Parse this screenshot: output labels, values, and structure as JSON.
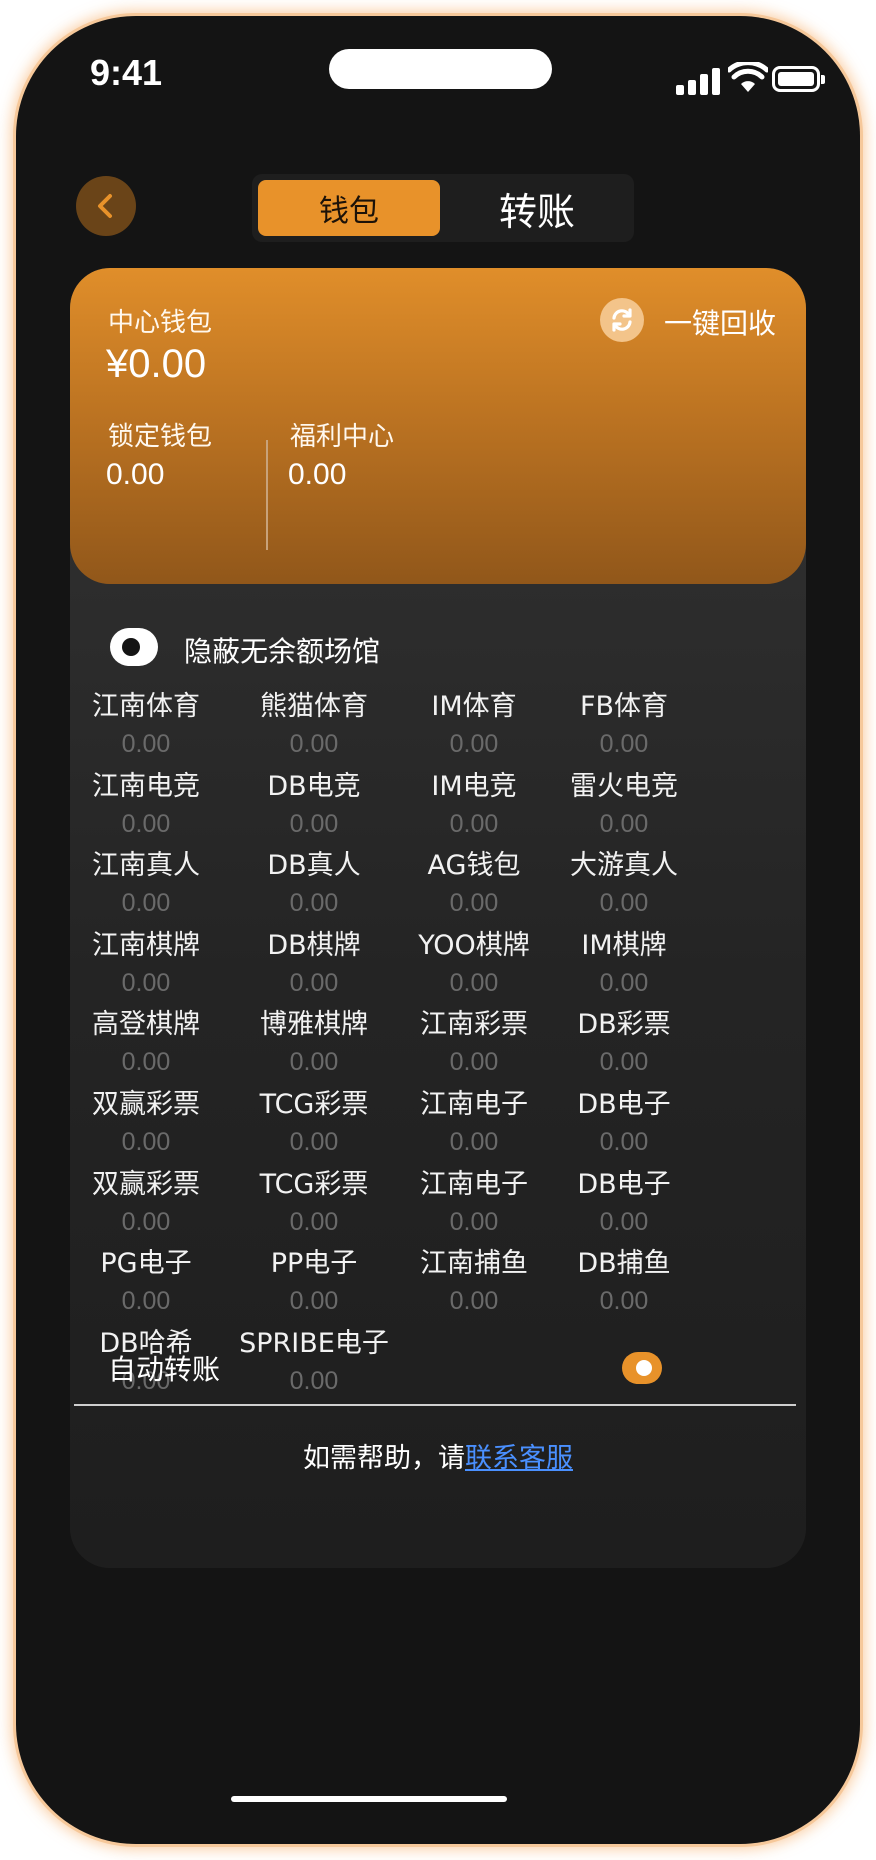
{
  "status_bar": {
    "time": "9:41"
  },
  "header": {
    "tabs": [
      {
        "label": "钱包",
        "active": true
      },
      {
        "label": "转账",
        "active": false
      }
    ]
  },
  "wallet": {
    "center_label": "中心钱包",
    "center_amount": "¥0.00",
    "recycle_label": "一键回收",
    "locked_label": "锁定钱包",
    "locked_amount": "0.00",
    "welfare_label": "福利中心",
    "welfare_amount": "0.00"
  },
  "hide_toggle": {
    "label": "隐蔽无余额场馆",
    "on": true
  },
  "venues": [
    {
      "name": "江南体育",
      "amount": "0.00"
    },
    {
      "name": "熊猫体育",
      "amount": "0.00"
    },
    {
      "name": "IM体育",
      "amount": "0.00"
    },
    {
      "name": "FB体育",
      "amount": "0.00"
    },
    {
      "name": "江南电竞",
      "amount": "0.00"
    },
    {
      "name": "DB电竞",
      "amount": "0.00"
    },
    {
      "name": "IM电竞",
      "amount": "0.00"
    },
    {
      "name": "雷火电竞",
      "amount": "0.00"
    },
    {
      "name": "江南真人",
      "amount": "0.00"
    },
    {
      "name": "DB真人",
      "amount": "0.00"
    },
    {
      "name": "AG钱包",
      "amount": "0.00"
    },
    {
      "name": "大游真人",
      "amount": "0.00"
    },
    {
      "name": "江南棋牌",
      "amount": "0.00"
    },
    {
      "name": "DB棋牌",
      "amount": "0.00"
    },
    {
      "name": "YOO棋牌",
      "amount": "0.00"
    },
    {
      "name": "IM棋牌",
      "amount": "0.00"
    },
    {
      "name": "高登棋牌",
      "amount": "0.00"
    },
    {
      "name": "博雅棋牌",
      "amount": "0.00"
    },
    {
      "name": "江南彩票",
      "amount": "0.00"
    },
    {
      "name": "DB彩票",
      "amount": "0.00"
    },
    {
      "name": "双赢彩票",
      "amount": "0.00"
    },
    {
      "name": "TCG彩票",
      "amount": "0.00"
    },
    {
      "name": "江南电子",
      "amount": "0.00"
    },
    {
      "name": "DB电子",
      "amount": "0.00"
    },
    {
      "name": "双赢彩票",
      "amount": "0.00"
    },
    {
      "name": "TCG彩票",
      "amount": "0.00"
    },
    {
      "name": "江南电子",
      "amount": "0.00"
    },
    {
      "name": "DB电子",
      "amount": "0.00"
    },
    {
      "name": "PG电子",
      "amount": "0.00"
    },
    {
      "name": "PP电子",
      "amount": "0.00"
    },
    {
      "name": "江南捕鱼",
      "amount": "0.00"
    },
    {
      "name": "DB捕鱼",
      "amount": "0.00"
    },
    {
      "name": "DB哈希",
      "amount": "0.00"
    },
    {
      "name": "SPRIBE电子",
      "amount": "0.00"
    }
  ],
  "auto_transfer": {
    "label": "自动转账",
    "on": true
  },
  "help": {
    "prefix": "如需帮助，请",
    "link": "联系客服"
  },
  "colors": {
    "accent": "#e8922a",
    "link": "#4a90ff",
    "background": "#141414"
  }
}
